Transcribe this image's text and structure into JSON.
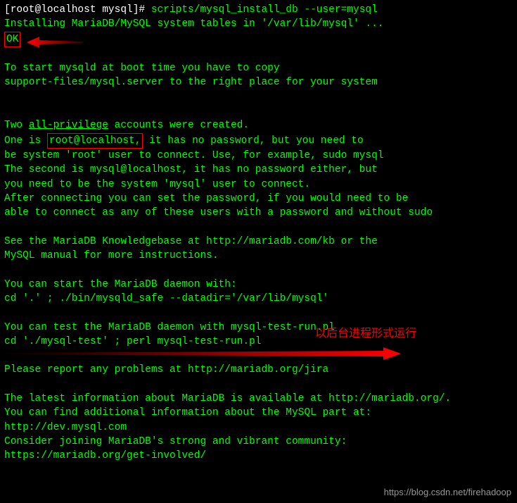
{
  "prompt": "[root@localhost mysql]# ",
  "command": "scripts/mysql_install_db --user=mysql",
  "l2": "Installing MariaDB/MySQL system tables in '/var/lib/mysql' ...",
  "ok": "OK",
  "l3": "To start mysqld at boot time you have to copy",
  "l4": "support-files/mysql.server to the right place for your system",
  "l5a": "Two ",
  "l5b": "all-privilege",
  "l5c": " accounts were created.",
  "l6a": "One is ",
  "l6b": "root@localhost,",
  "l6c": " it has no password, but you need to",
  "l7": "be system 'root' user to connect. Use, for example, sudo mysql",
  "l8": "The second is mysql@localhost, it has no password either, but",
  "l9": "you need to be the system 'mysql' user to connect.",
  "l10": "After connecting you can set the password, if you would need to be",
  "l11": "able to connect as any of these users with a password and without sudo",
  "l12": "See the MariaDB Knowledgebase at http://mariadb.com/kb or the",
  "l13": "MySQL manual for more instructions.",
  "l14": "You can start the MariaDB daemon with:",
  "l15": "cd '.' ; ./bin/mysqld_safe --datadir='/var/lib/mysql'",
  "l16": "You can test the MariaDB daemon with mysql-test-run.pl",
  "l17": "cd './mysql-test' ; perl mysql-test-run.pl",
  "l18": "Please report any problems at http://mariadb.org/jira",
  "l19": "The latest information about MariaDB is available at http://mariadb.org/.",
  "l20": "You can find additional information about the MySQL part at:",
  "l21": "http://dev.mysql.com",
  "l22": "Consider joining MariaDB's strong and vibrant community:",
  "l23": "https://mariadb.org/get-involved/",
  "annotation": "以后台进程形式运行",
  "watermark": "https://blog.csdn.net/firehadoop"
}
